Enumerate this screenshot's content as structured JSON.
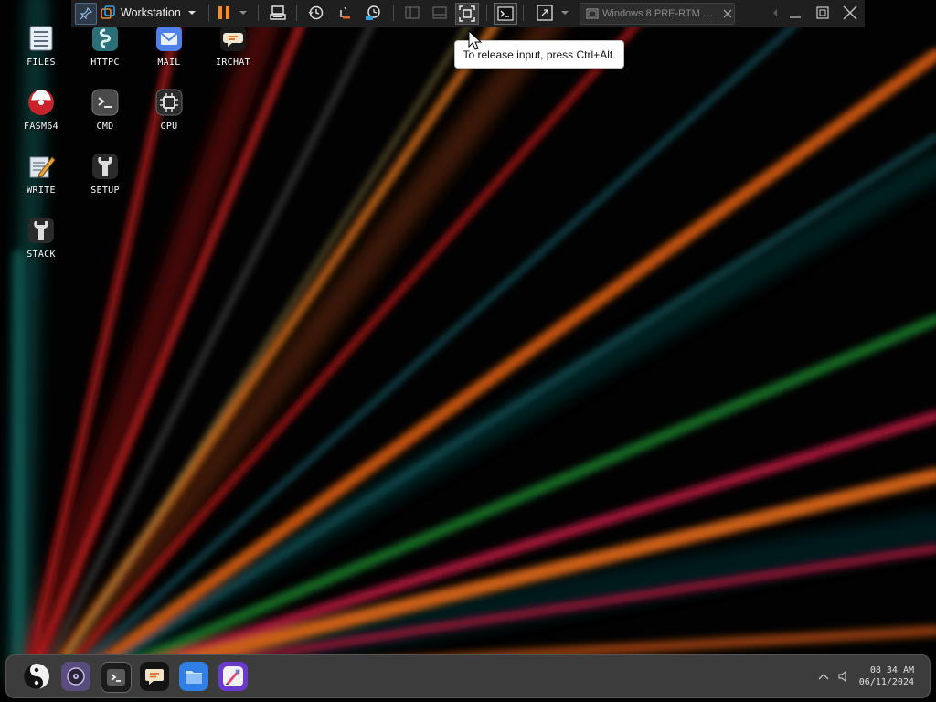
{
  "desktop": {
    "icons": [
      {
        "label": "FILES",
        "icon": "files-icon"
      },
      {
        "label": "HTTPC",
        "icon": "httpc-icon"
      },
      {
        "label": "MAIL",
        "icon": "mail-icon"
      },
      {
        "label": "IRCHAT",
        "icon": "irchat-icon"
      },
      {
        "label": "FASM64",
        "icon": "fasm64-icon"
      },
      {
        "label": "CMD",
        "icon": "terminal-icon"
      },
      {
        "label": "CPU",
        "icon": "cpu-icon"
      },
      {
        "label": "WRITE",
        "icon": "write-icon"
      },
      {
        "label": "SETUP",
        "icon": "wrench-icon"
      },
      {
        "label": "STACK",
        "icon": "wrench-icon"
      }
    ]
  },
  "vmware_toolbar": {
    "product_label": "Workstation",
    "vm_tab_title": "Windows 8 PRE-RTM Bui…",
    "colors": {
      "background": "#1f1f1f",
      "pause_accent": "#ff8c1a"
    }
  },
  "tooltip": {
    "text": "To release input, press Ctrl+Alt."
  },
  "taskbar": {
    "clock_time": "08 34 AM",
    "clock_date": "06/11/2024",
    "pinned": [
      "yin-yang-icon",
      "disc-icon",
      "terminal-icon",
      "chat-icon",
      "files-icon",
      "paint-icon"
    ]
  }
}
